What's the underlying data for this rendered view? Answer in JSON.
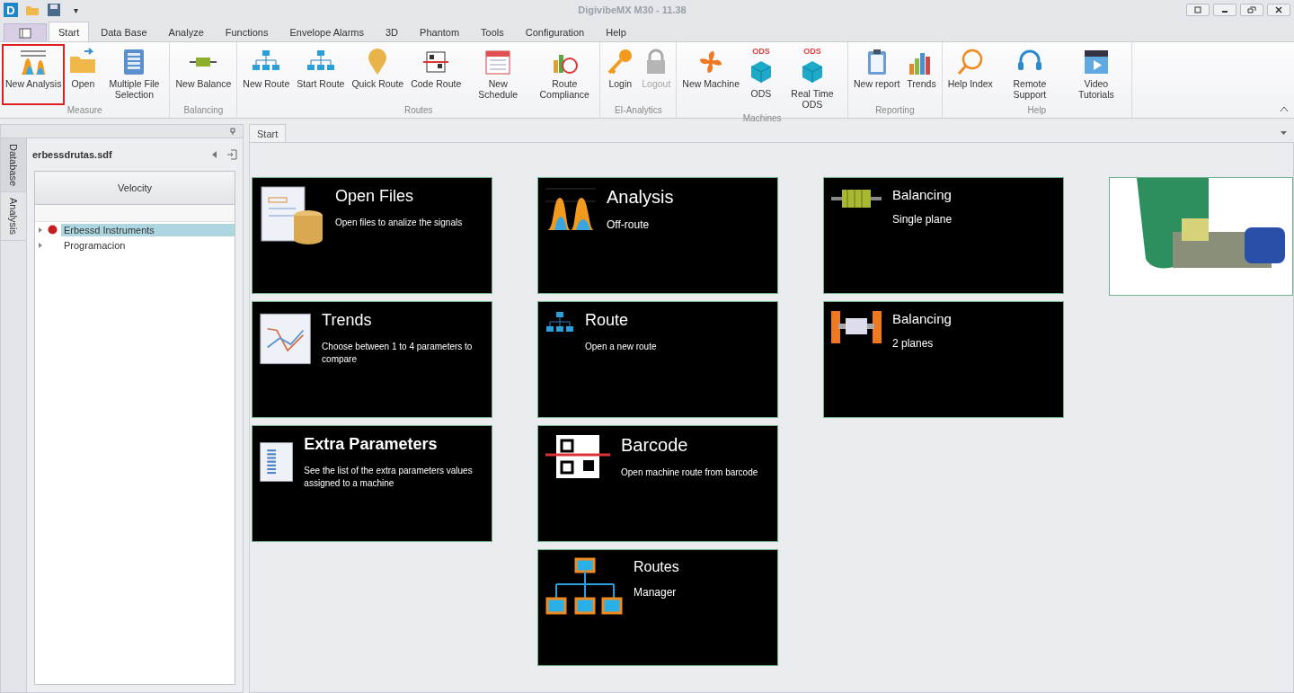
{
  "window": {
    "logo": "D",
    "title": "DigivibeMX M30 - 11.38",
    "quick_access_menu": "▾"
  },
  "ribbon_tabs": [
    {
      "label": "Start",
      "selected": true
    },
    {
      "label": "Data Base",
      "selected": false
    },
    {
      "label": "Analyze",
      "selected": false
    },
    {
      "label": "Functions",
      "selected": false
    },
    {
      "label": "Envelope Alarms",
      "selected": false
    },
    {
      "label": "3D",
      "selected": false
    },
    {
      "label": "Phantom",
      "selected": false
    },
    {
      "label": "Tools",
      "selected": false
    },
    {
      "label": "Configuration",
      "selected": false
    },
    {
      "label": "Help",
      "selected": false
    }
  ],
  "ribbon_groups": [
    {
      "label": "Measure",
      "buttons": [
        {
          "label": "New Analysis",
          "highlighted": true,
          "disabled": false
        },
        {
          "label": "Open",
          "highlighted": false,
          "disabled": false
        },
        {
          "label": "Multiple File Selection",
          "highlighted": false,
          "disabled": false
        }
      ]
    },
    {
      "label": "Balancing",
      "buttons": [
        {
          "label": "New Balance",
          "highlighted": false,
          "disabled": false
        }
      ]
    },
    {
      "label": "Routes",
      "buttons": [
        {
          "label": "New Route",
          "highlighted": false,
          "disabled": false
        },
        {
          "label": "Start Route",
          "highlighted": false,
          "disabled": false
        },
        {
          "label": "Quick Route",
          "highlighted": false,
          "disabled": false
        },
        {
          "label": "Code Route",
          "highlighted": false,
          "disabled": false
        },
        {
          "label": "New Schedule",
          "highlighted": false,
          "disabled": false
        },
        {
          "label": "Route Compliance",
          "highlighted": false,
          "disabled": false
        }
      ]
    },
    {
      "label": "EI-Analytics",
      "buttons": [
        {
          "label": "Login",
          "highlighted": false,
          "disabled": false
        },
        {
          "label": "Logout",
          "highlighted": false,
          "disabled": true
        }
      ]
    },
    {
      "label": "Machines",
      "buttons": [
        {
          "label": "New Machine",
          "highlighted": false,
          "disabled": false
        },
        {
          "label": "ODS",
          "badge": "ODS",
          "highlighted": false,
          "disabled": false
        },
        {
          "label": "Real Time ODS",
          "badge": "ODS",
          "highlighted": false,
          "disabled": false
        }
      ]
    },
    {
      "label": "Reporting",
      "buttons": [
        {
          "label": "New report",
          "highlighted": false,
          "disabled": false
        },
        {
          "label": "Trends",
          "highlighted": false,
          "disabled": false
        }
      ]
    },
    {
      "label": "Help",
      "buttons": [
        {
          "label": "Help Index",
          "highlighted": false,
          "disabled": false
        },
        {
          "label": "Remote Support",
          "highlighted": false,
          "disabled": false
        },
        {
          "label": "Video Tutorials",
          "highlighted": false,
          "disabled": false
        }
      ]
    }
  ],
  "side_tabs": [
    {
      "label": "Database",
      "selected": true
    },
    {
      "label": "Analysis",
      "selected": false
    }
  ],
  "database_panel": {
    "title": "erbessdrutas.sdf",
    "header": "Velocity",
    "tree": [
      {
        "label": "Erbessd Instruments",
        "selected": true,
        "expanded": false
      },
      {
        "label": "Programacion",
        "selected": false,
        "expanded": false
      }
    ]
  },
  "document_tabs": [
    {
      "label": "Start",
      "selected": true
    }
  ],
  "tile_columns": [
    [
      {
        "title": "Open Files",
        "subtitle": "Open files to analize the signals"
      },
      {
        "title": "Trends",
        "subtitle": "Choose between 1 to 4 parameters to compare"
      },
      {
        "title": "Extra Parameters",
        "subtitle": "See the list of the extra parameters values assigned to a machine"
      }
    ],
    [
      {
        "title": "Analysis",
        "subtitle": "Off-route"
      },
      {
        "title": "Route",
        "subtitle": "Open a new route"
      },
      {
        "title": "Barcode",
        "subtitle": "Open machine route from barcode"
      },
      {
        "title": "Routes",
        "subtitle": "Manager"
      }
    ],
    [
      {
        "title": "Balancing",
        "subtitle": "Single plane"
      },
      {
        "title": "Balancing",
        "subtitle": "2 planes"
      }
    ]
  ]
}
